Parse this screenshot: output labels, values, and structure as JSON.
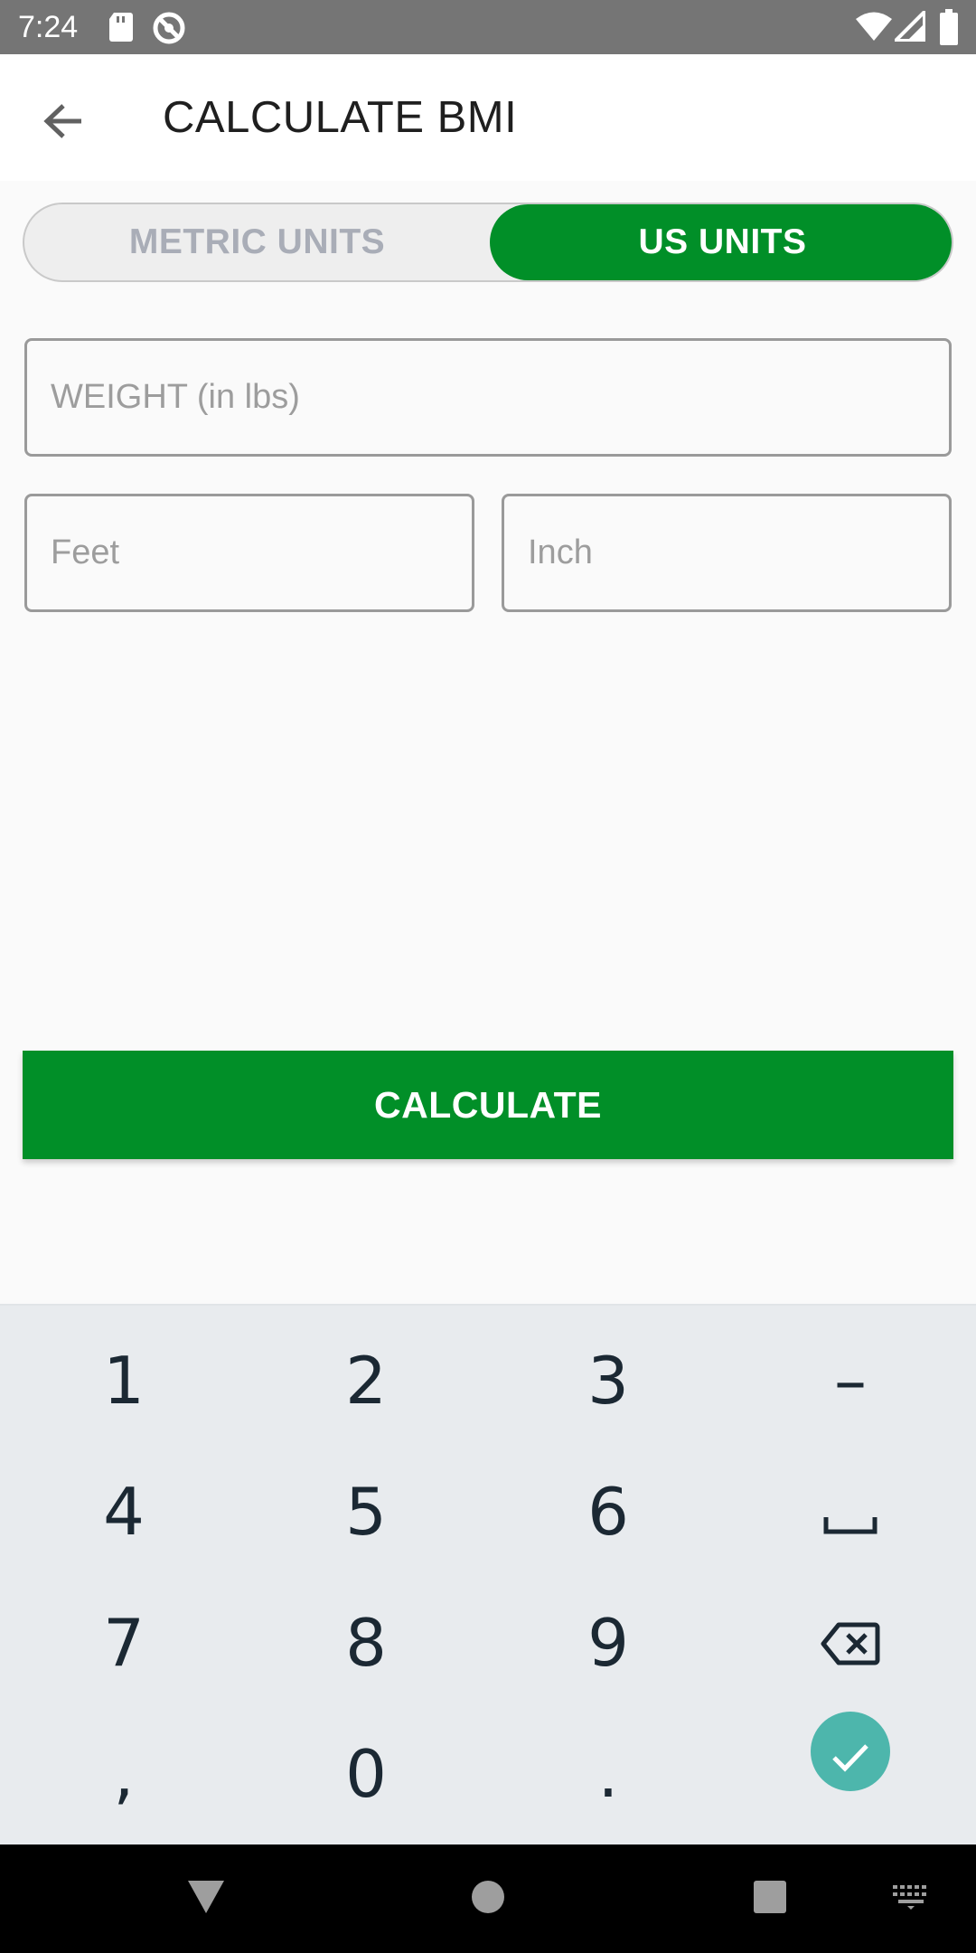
{
  "status_bar": {
    "time": "7:24",
    "icons": [
      "sd-card-icon",
      "no-sync-icon",
      "wifi-icon",
      "signal-icon",
      "battery-icon"
    ]
  },
  "app_bar": {
    "title": "CALCULATE BMI",
    "back_icon": "arrow-left-icon"
  },
  "unit_toggle": {
    "tabs": [
      {
        "label": "METRIC UNITS",
        "selected": false
      },
      {
        "label": "US UNITS",
        "selected": true
      }
    ],
    "accent": "#018f28"
  },
  "form": {
    "weight": {
      "placeholder": "WEIGHT (in lbs)",
      "value": ""
    },
    "feet": {
      "placeholder": "Feet",
      "value": ""
    },
    "inch": {
      "placeholder": "Inch",
      "value": ""
    }
  },
  "calculate_button": {
    "label": "CALCULATE"
  },
  "keyboard": {
    "rows": [
      [
        "1",
        "2",
        "3",
        "–"
      ],
      [
        "4",
        "5",
        "6",
        "space"
      ],
      [
        "7",
        "8",
        "9",
        "backspace"
      ],
      [
        ",",
        "0",
        ".",
        "done"
      ]
    ],
    "enter_color": "#4db6ac"
  },
  "nav_bar": {
    "buttons": [
      "back-triangle-icon",
      "home-circle-icon",
      "recents-square-icon",
      "keyboard-switch-icon"
    ]
  }
}
